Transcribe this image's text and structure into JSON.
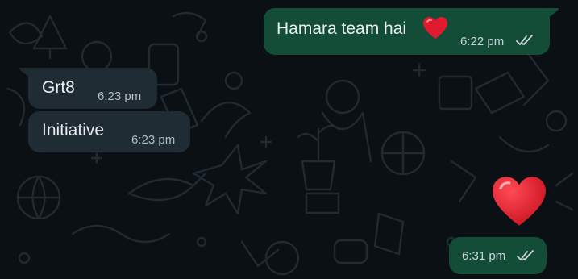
{
  "chat": {
    "messages": [
      {
        "direction": "outgoing",
        "text": "Hamara team hai",
        "emoji": "heart",
        "time": "6:22 pm",
        "status": "read-ticks"
      },
      {
        "direction": "incoming",
        "text": "Grt8",
        "time": "6:23 pm"
      },
      {
        "direction": "incoming",
        "text": "Initiative",
        "time": "6:23 pm"
      },
      {
        "direction": "outgoing",
        "emoji": "heart",
        "time": "6:31 pm",
        "status": "read-ticks"
      }
    ]
  },
  "colors": {
    "background": "#0b1014",
    "outgoing_bubble": "#144d37",
    "incoming_bubble": "#1f2c33",
    "text": "#e9edef",
    "heart": "#e01b2f"
  },
  "icons": [
    "heart-emoji-icon",
    "double-check-icon",
    "doodle-wallpaper"
  ]
}
